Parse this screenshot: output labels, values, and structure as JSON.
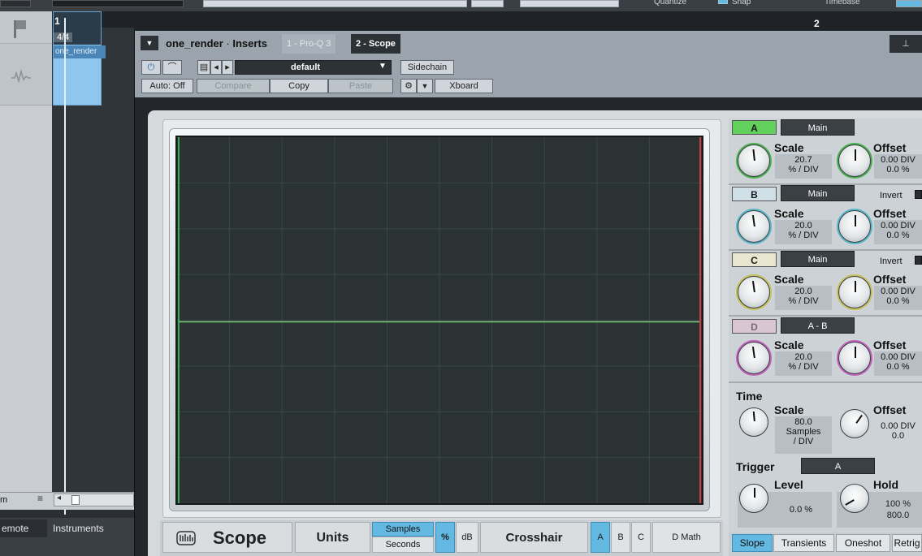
{
  "top_strip": {
    "quantize_label": "Quantize",
    "snap_label": "Snap",
    "timebase_label": "Timebase"
  },
  "timeline": {
    "bar_1": "1",
    "bar_2": "2",
    "time_signature": "4/4",
    "clip_name": "one_render"
  },
  "left_panel": {
    "footer_label": "m",
    "tabs": [
      "emote",
      "Instruments"
    ]
  },
  "plugin": {
    "title_track": "one_render",
    "title_sep": " · ",
    "title_suffix": "Inserts",
    "tabs": [
      "1 - Pro-Q 3",
      "2 - Scope"
    ],
    "active_tab": "2 - Scope",
    "preset": "default",
    "sidechain_label": "Sidechain",
    "auto_label": "Auto: Off",
    "compare_label": "Compare",
    "copy_label": "Copy",
    "paste_label": "Paste",
    "xboard_label": "Xboard"
  },
  "scope": {
    "brand": "Scope",
    "units_label": "Units",
    "units_options": [
      "Samples",
      "Seconds"
    ],
    "units_selected": "Samples",
    "scale_options": [
      "%",
      "dB"
    ],
    "scale_selected": "%",
    "crosshair_label": "Crosshair",
    "crosshair_options": [
      "A",
      "B",
      "C",
      "D Math"
    ],
    "crosshair_selected": "A",
    "grid": {
      "cols": 10,
      "rows": 8
    },
    "colors": {
      "screen": "#2a3234",
      "grid": "#3a4648",
      "trace": "#7ed07e",
      "left_marker": "#3fd05a",
      "right_marker": "#d03a3a"
    }
  },
  "channels": [
    {
      "id": "A",
      "source": "Main",
      "scale_label": "Scale",
      "scale_value": "20.7",
      "scale_unit": "% / DIV",
      "offset_label": "Offset",
      "offset_div": "0.00 DIV",
      "offset_pct": "0.0 %",
      "color": "#62d05c",
      "ring": "#4caf50",
      "invert": false
    },
    {
      "id": "B",
      "source": "Main",
      "scale_label": "Scale",
      "scale_value": "20.0",
      "scale_unit": "% / DIV",
      "offset_label": "Offset",
      "offset_div": "0.00 DIV",
      "offset_pct": "0.0 %",
      "color": "#cfe0e8",
      "ring": "#58b6c7",
      "invert_label": "Invert"
    },
    {
      "id": "C",
      "source": "Main",
      "scale_label": "Scale",
      "scale_value": "20.0",
      "scale_unit": "% / DIV",
      "offset_label": "Offset",
      "offset_div": "0.00 DIV",
      "offset_pct": "0.0 %",
      "color": "#e8e6cf",
      "ring": "#c7c058",
      "invert_label": "Invert"
    },
    {
      "id": "D",
      "source": "A - B",
      "scale_label": "Scale",
      "scale_value": "20.0",
      "scale_unit": "% / DIV",
      "offset_label": "Offset",
      "offset_div": "0.00 DIV",
      "offset_pct": "0.0 %",
      "color": "#d9c6d2",
      "ring": "#c060b8"
    }
  ],
  "time": {
    "section_label": "Time",
    "scale_label": "Scale",
    "scale_value": "80.0",
    "scale_unit_1": "Samples",
    "scale_unit_2": "/ DIV",
    "offset_label": "Offset",
    "offset_div": "0.00 DIV",
    "offset_value": "0.0"
  },
  "trigger": {
    "section_label": "Trigger",
    "source": "A",
    "level_label": "Level",
    "level_value": "0.0 %",
    "hold_label": "Hold",
    "hold_pct": "100 %",
    "hold_value": "800.0",
    "modes": [
      "Slope",
      "Transients",
      "Oneshot",
      "Retrig"
    ],
    "mode_selected": "Slope"
  }
}
